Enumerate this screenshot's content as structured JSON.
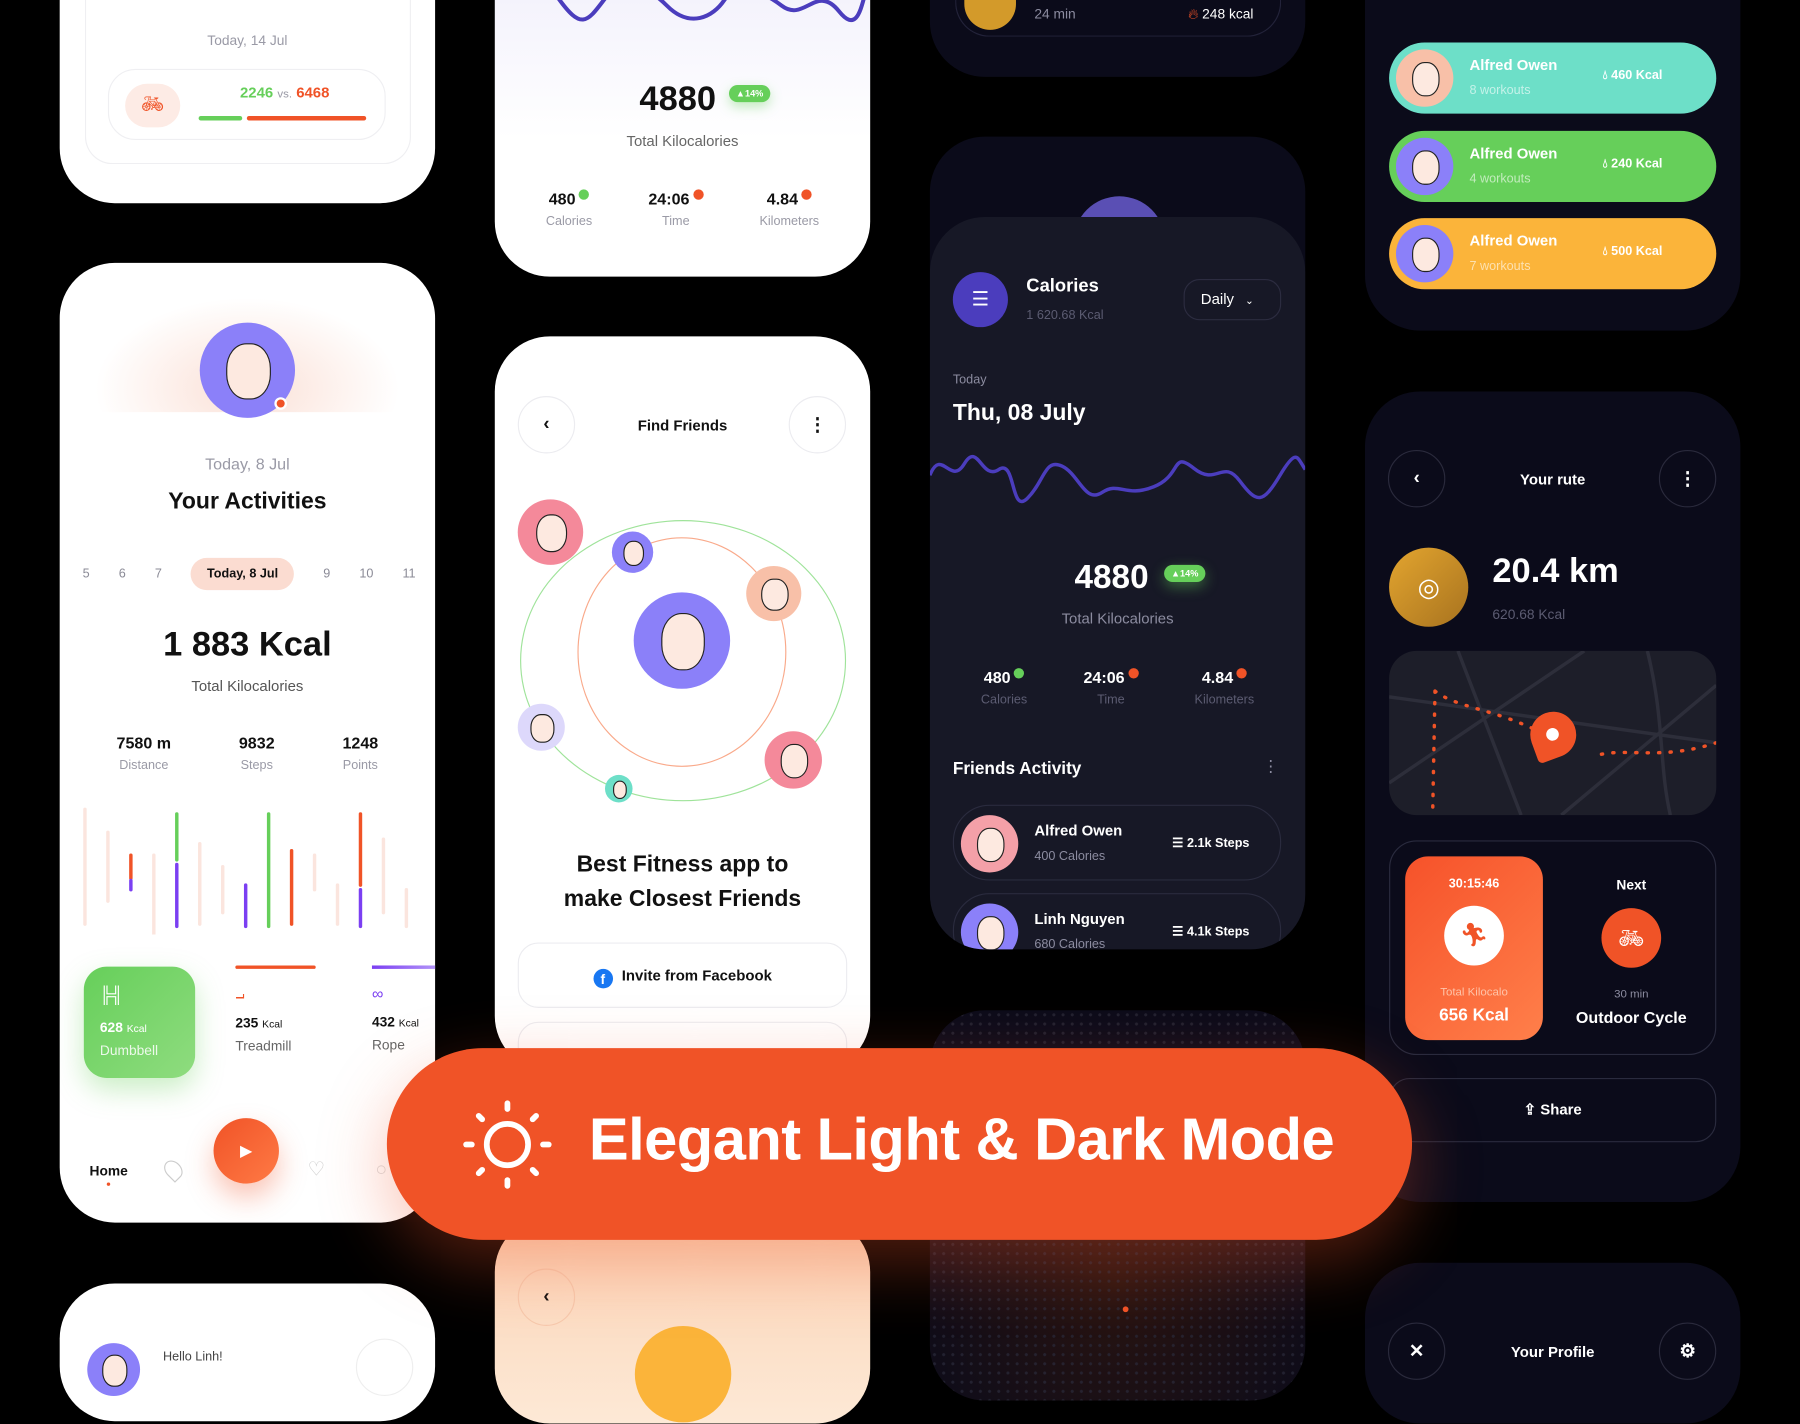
{
  "colors": {
    "accent": "#f05327",
    "green": "#66cf5a",
    "purple": "#7b3ff2",
    "teal": "#6ddfc8",
    "yellow": "#fbb43a",
    "dark_bg": "#0b0b1a",
    "panel": "#171826"
  },
  "card_compare": {
    "date": "Today, 14 Jul",
    "mine": "2246",
    "vs": "vs.",
    "theirs": "6468",
    "icon": "bicycle-icon",
    "mine_progress": 0.26
  },
  "card_kcal_light": {
    "total": "4880",
    "badge": "14%",
    "label": "Total Kilocalories",
    "stats": [
      {
        "value": "480",
        "label": "Calories",
        "trend": "up"
      },
      {
        "value": "24:06",
        "label": "Time",
        "trend": "down"
      },
      {
        "value": "4.84",
        "label": "Kilometers",
        "trend": "down"
      }
    ]
  },
  "card_activities": {
    "date": "Today, 8 Jul",
    "title": "Your Activities",
    "days": [
      "5",
      "6",
      "7",
      "Today, 8 Jul",
      "9",
      "10",
      "11"
    ],
    "selected_day": "Today, 8 Jul",
    "kcal": "1 883 Kcal",
    "kcal_label": "Total Kilocalories",
    "stats": [
      {
        "value": "7580 m",
        "label": "Distance"
      },
      {
        "value": "9832",
        "label": "Steps"
      },
      {
        "value": "1248",
        "label": "Points"
      }
    ],
    "workouts": [
      {
        "value": "628",
        "unit": "Kcal",
        "name": "Dumbbell",
        "icon": "dumbbell-icon"
      },
      {
        "value": "235",
        "unit": "Kcal",
        "name": "Treadmill",
        "icon": "treadmill-icon"
      },
      {
        "value": "432",
        "unit": "Kcal",
        "name": "Rope",
        "icon": "jump-rope-icon"
      }
    ],
    "nav": {
      "home": "Home",
      "icons": [
        "location-pin-icon",
        "play-icon",
        "heart-icon",
        "medal-icon"
      ]
    }
  },
  "card_hello": {
    "greeting": "Hello Linh!"
  },
  "card_friends": {
    "title": "Find Friends",
    "headline_1": "Best Fitness app to",
    "headline_2": "make Closest Friends",
    "facebook_button": "Invite from Facebook"
  },
  "card_workout_top": {
    "duration": "24 min",
    "kcal": "248 kcal"
  },
  "card_calories_dark": {
    "title": "Calories",
    "subtitle": "1 620.68 Kcal",
    "period": "Daily",
    "today_label": "Today",
    "date": "Thu, 08 July",
    "total": "4880",
    "badge": "14%",
    "total_label": "Total Kilocalories",
    "stats": [
      {
        "value": "480",
        "label": "Calories",
        "trend": "up"
      },
      {
        "value": "24:06",
        "label": "Time",
        "trend": "down"
      },
      {
        "value": "4.84",
        "label": "Kilometers",
        "trend": "down"
      }
    ],
    "friends_title": "Friends Activity",
    "friends": [
      {
        "name": "Alfred Owen",
        "calories": "400 Calories",
        "steps": "2.1k Steps"
      },
      {
        "name": "Linh Nguyen",
        "calories": "680 Calories",
        "steps": "4.1k Steps"
      }
    ]
  },
  "card_leaderboard": {
    "rows": [
      {
        "name": "Alfred Owen",
        "workouts": "8 workouts",
        "kcal": "460 Kcal",
        "color": "#6ddfc8"
      },
      {
        "name": "Alfred Owen",
        "workouts": "4 workouts",
        "kcal": "240 Kcal",
        "color": "#66cf5a"
      },
      {
        "name": "Alfred Owen",
        "workouts": "7 workouts",
        "kcal": "500 Kcal",
        "color": "#fbb43a"
      }
    ]
  },
  "card_route": {
    "title": "Your rute",
    "distance": "20.4 km",
    "kcal": "620.68 Kcal",
    "timer": "30:15:46",
    "current_label": "Total Kilocalo",
    "current_kcal": "656 Kcal",
    "next_label": "Next",
    "next_duration": "30 min",
    "next_name": "Outdoor Cycle",
    "share": "Share"
  },
  "card_profile": {
    "title": "Your Profile"
  },
  "banner": {
    "text": "Elegant Light & Dark Mode",
    "icon": "sun-icon"
  }
}
